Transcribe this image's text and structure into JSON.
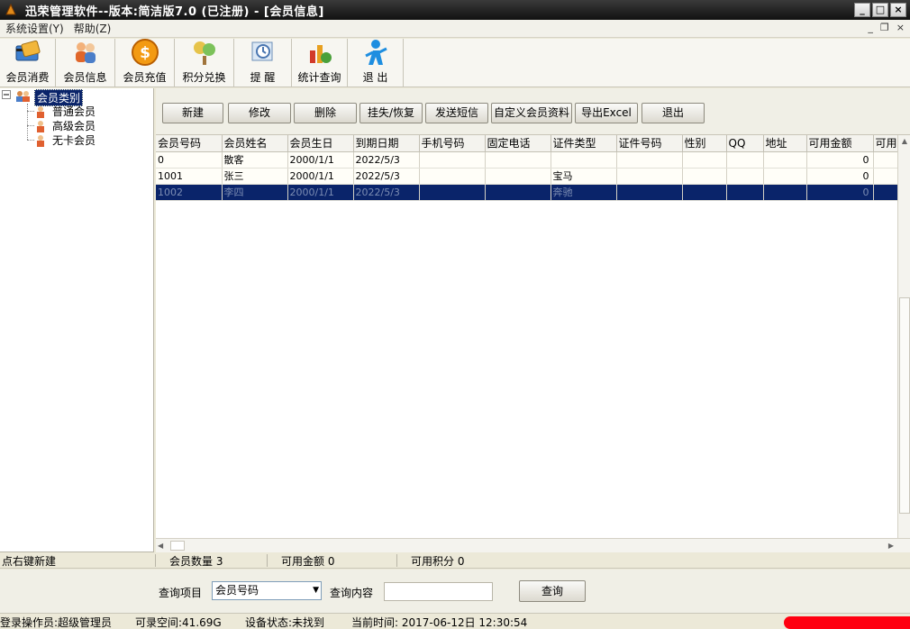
{
  "window": {
    "title": "迅荣管理软件--版本:简洁版7.0 (已注册) - [会员信息]",
    "controls": {
      "minimize": "_",
      "maximize": "□",
      "close": "×"
    }
  },
  "menu": {
    "items": [
      "系统设置(Y)",
      "帮助(Z)"
    ],
    "mdi": {
      "minimize": "_",
      "restore": "❐",
      "close": "×"
    }
  },
  "toolbar": {
    "items": [
      {
        "label": "会员消费",
        "icon": "card-icon"
      },
      {
        "label": "会员信息",
        "icon": "members-icon"
      },
      {
        "label": "会员充值",
        "icon": "dollar-coin-icon"
      },
      {
        "label": "积分兑换",
        "icon": "exchange-icon"
      },
      {
        "label": "提 醒",
        "icon": "reminder-icon"
      },
      {
        "label": "统计查询",
        "icon": "statistics-icon"
      },
      {
        "label": "退 出",
        "icon": "exit-person-icon"
      }
    ]
  },
  "tree": {
    "root": "会员类别",
    "children": [
      "普通会员",
      "高级会员",
      "无卡会员"
    ]
  },
  "actions": {
    "new": "新建",
    "edit": "修改",
    "delete": "删除",
    "suspend": "挂失/恢复",
    "sms": "发送短信",
    "custom": "自定义会员资料",
    "export": "导出Excel",
    "exit": "退出"
  },
  "grid": {
    "columns": [
      "会员号码",
      "会员姓名",
      "会员生日",
      "到期日期",
      "手机号码",
      "固定电话",
      "证件类型",
      "证件号码",
      "性别",
      "QQ",
      "地址",
      "可用金额",
      "可用"
    ],
    "rows": [
      [
        "0",
        "散客",
        "2000/1/1",
        "2022/5/3",
        "",
        "",
        "",
        "",
        "",
        "",
        "",
        "0",
        ""
      ],
      [
        "1001",
        "张三",
        "2000/1/1",
        "2022/5/3",
        "",
        "",
        "宝马",
        "",
        "",
        "",
        "",
        "0",
        ""
      ],
      [
        "1002",
        "李四",
        "2000/1/1",
        "2022/5/3",
        "",
        "",
        "奔驰",
        "",
        "",
        "",
        "",
        "0",
        ""
      ]
    ],
    "selected_row": 2
  },
  "summary": {
    "hint": "点右键新建",
    "member_count": "会员数量 3",
    "available_amount": "可用金额 0",
    "available_points": "可用积分 0"
  },
  "query": {
    "item_label": "查询项目",
    "item_value": "会员号码",
    "content_label": "查询内容",
    "content_value": "",
    "button": "查询"
  },
  "status": {
    "operator": "登录操作员:超级管理员",
    "space": "可录空间:41.69G",
    "device": "设备状态:未找到",
    "time": "当前时间: 2017-06-12日 12:30:54"
  },
  "colors": {
    "selection": "#0a246a",
    "titlebar": "#1e1e1e",
    "redaction": "#ff0010"
  }
}
